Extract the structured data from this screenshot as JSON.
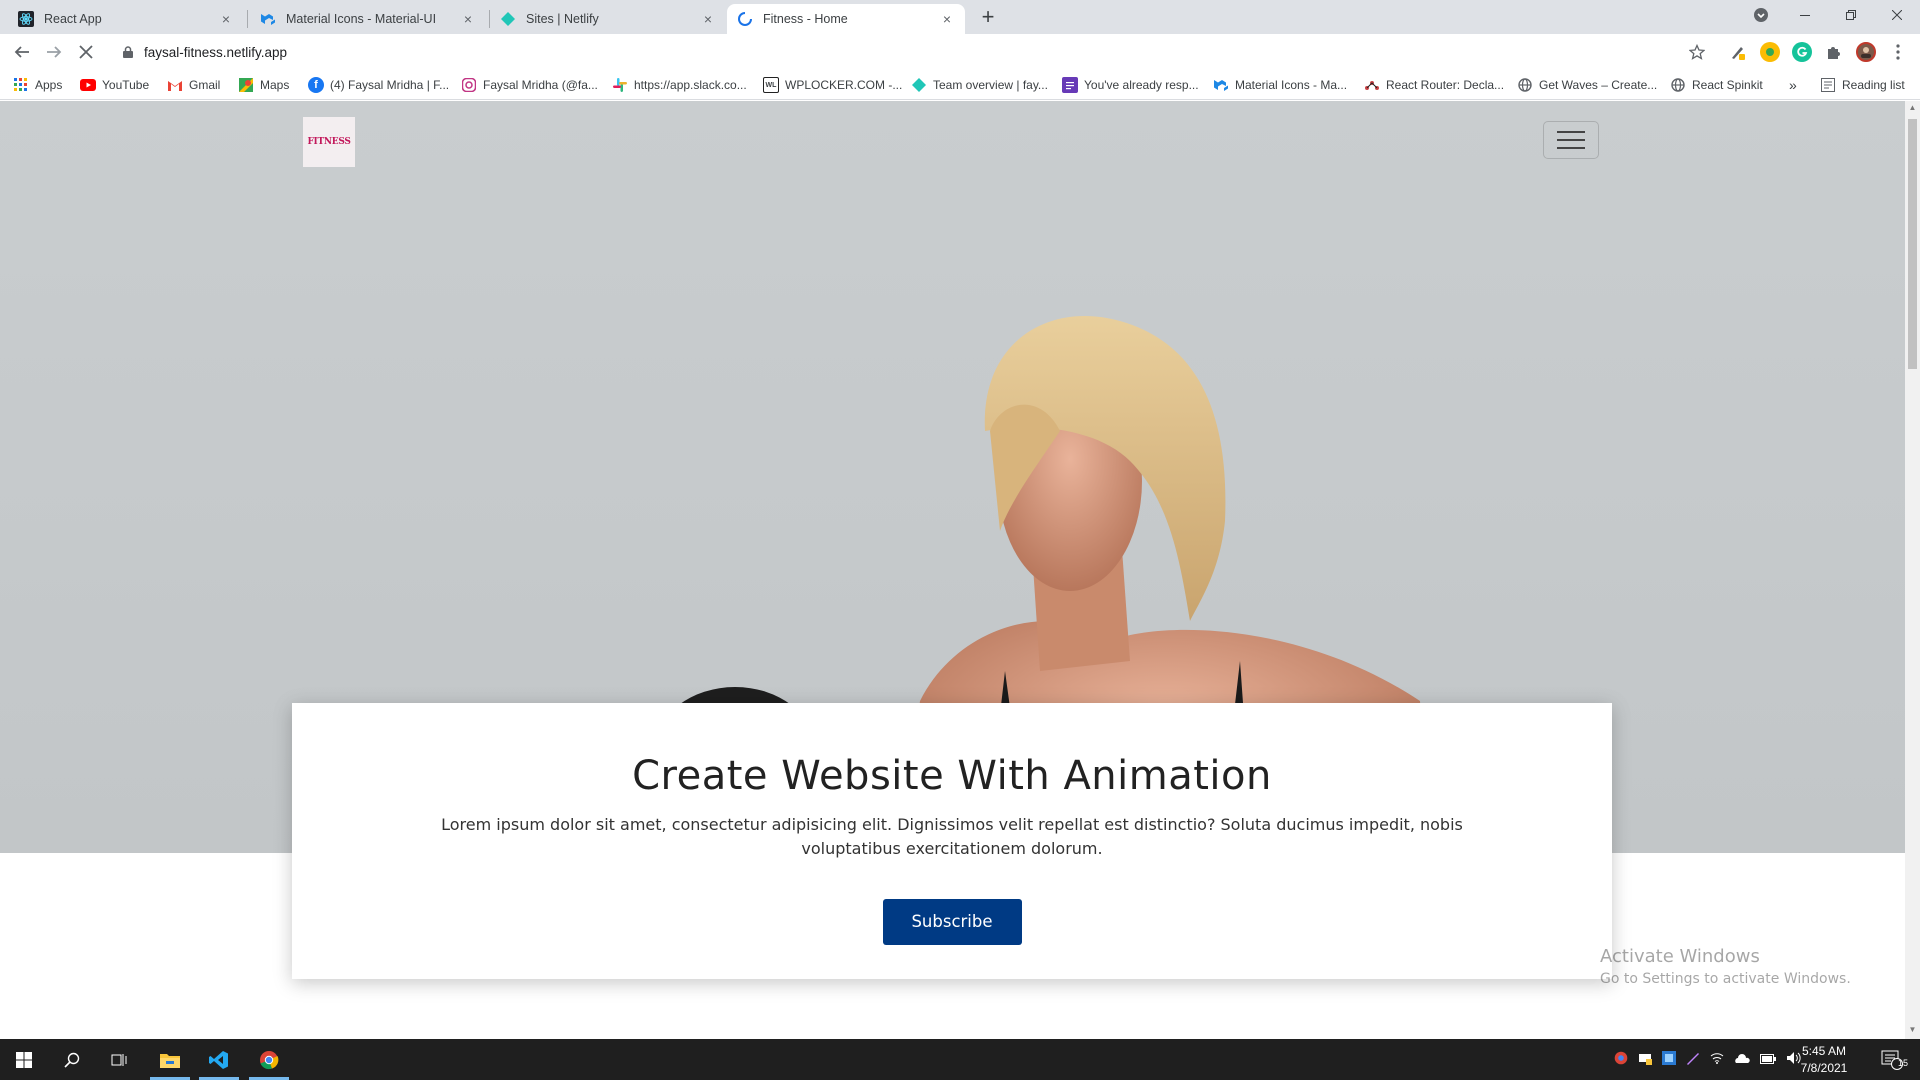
{
  "browser": {
    "tabs": [
      {
        "title": "React App",
        "icon": "react-icon",
        "active": false
      },
      {
        "title": "Material Icons - Material-UI",
        "icon": "material-ui-icon",
        "active": false
      },
      {
        "title": "Sites | Netlify",
        "icon": "netlify-icon",
        "active": false
      },
      {
        "title": "Fitness - Home",
        "icon": "loading-icon",
        "active": true
      }
    ],
    "tab_close": "×",
    "new_tab": "+",
    "url": "faysal-fitness.netlify.app",
    "bookmarks": [
      {
        "label": "Apps",
        "icon": "apps-grid-icon"
      },
      {
        "label": "YouTube",
        "icon": "youtube-icon"
      },
      {
        "label": "Gmail",
        "icon": "gmail-icon"
      },
      {
        "label": "Maps",
        "icon": "maps-icon"
      },
      {
        "label": "(4) Faysal Mridha | F...",
        "icon": "facebook-icon"
      },
      {
        "label": "Faysal Mridha (@fa...",
        "icon": "instagram-icon"
      },
      {
        "label": "https://app.slack.co...",
        "icon": "slack-icon"
      },
      {
        "label": "WPLOCKER.COM -...",
        "icon": "wplocker-icon"
      },
      {
        "label": "Team overview | fay...",
        "icon": "netlify-icon"
      },
      {
        "label": "You've already resp...",
        "icon": "forms-icon"
      },
      {
        "label": "Material Icons - Ma...",
        "icon": "material-ui-icon"
      },
      {
        "label": "React Router: Decla...",
        "icon": "react-router-icon"
      },
      {
        "label": "Get Waves – Create...",
        "icon": "globe-icon"
      },
      {
        "label": "React Spinkit",
        "icon": "globe-icon"
      }
    ],
    "bookmarks_more": "»",
    "reading_list": "Reading list"
  },
  "page": {
    "logo_text": "FITNESS",
    "hero_title": "Create Website With Animation",
    "hero_text": "Lorem ipsum dolor sit amet, consectetur adipisicing elit. Dignissimos velit repellat est distinctio? Soluta ducimus impedit, nobis voluptatibus exercitationem dolorum.",
    "subscribe_label": "Subscribe"
  },
  "watermark": {
    "line1": "Activate Windows",
    "line2": "Go to Settings to activate Windows."
  },
  "taskbar": {
    "time": "5:45 AM",
    "date": "7/8/2021",
    "notifications": "15"
  },
  "colors": {
    "subscribe_bg": "#003a84",
    "tabstrip": "#dee1e6",
    "taskbar": "#1f1f1f"
  }
}
